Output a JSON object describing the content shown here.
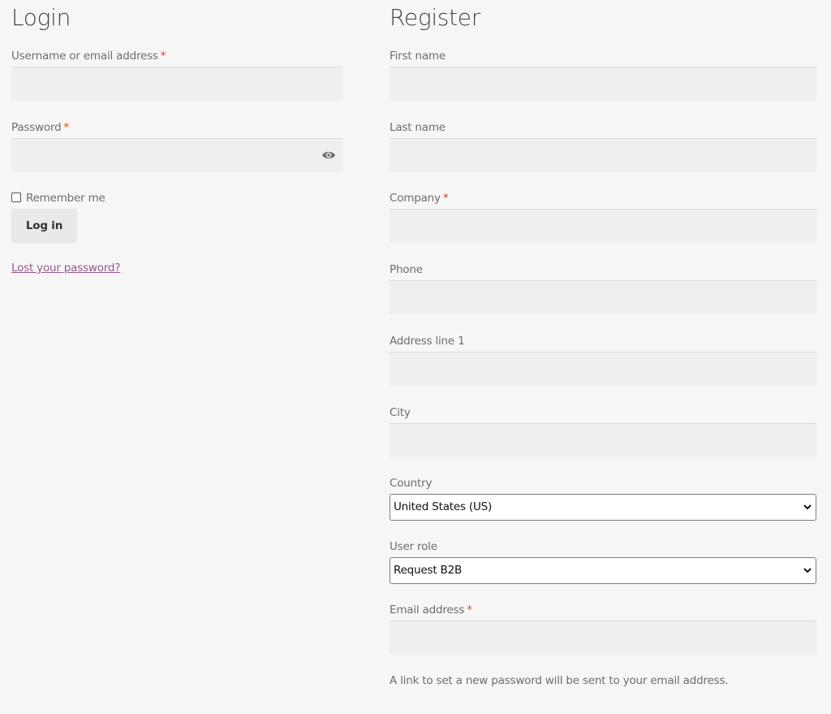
{
  "login": {
    "title": "Login",
    "username_label": "Username or email address",
    "password_label": "Password",
    "required_mark": "*",
    "remember_label": "Remember me",
    "login_button": "Log in",
    "lost_password_link": "Lost your password?",
    "icons": {
      "show_password": "eye-icon"
    }
  },
  "register": {
    "title": "Register",
    "first_name_label": "First name",
    "last_name_label": "Last name",
    "company_label": "Company",
    "phone_label": "Phone",
    "address_label": "Address line 1",
    "city_label": "City",
    "country_label": "Country",
    "country_value": "United States (US)",
    "user_role_label": "User role",
    "user_role_value": "Request B2B",
    "email_label": "Email address",
    "required_mark": "*",
    "password_note": "A link to set a new password will be sent to your email address.",
    "icons": {
      "select_arrow": "chevron-down-icon"
    }
  },
  "colors": {
    "background": "#f6f6f6",
    "input_background": "#efefef",
    "required": "#e2401c",
    "link": "#96588a",
    "heading": "#43454b"
  }
}
